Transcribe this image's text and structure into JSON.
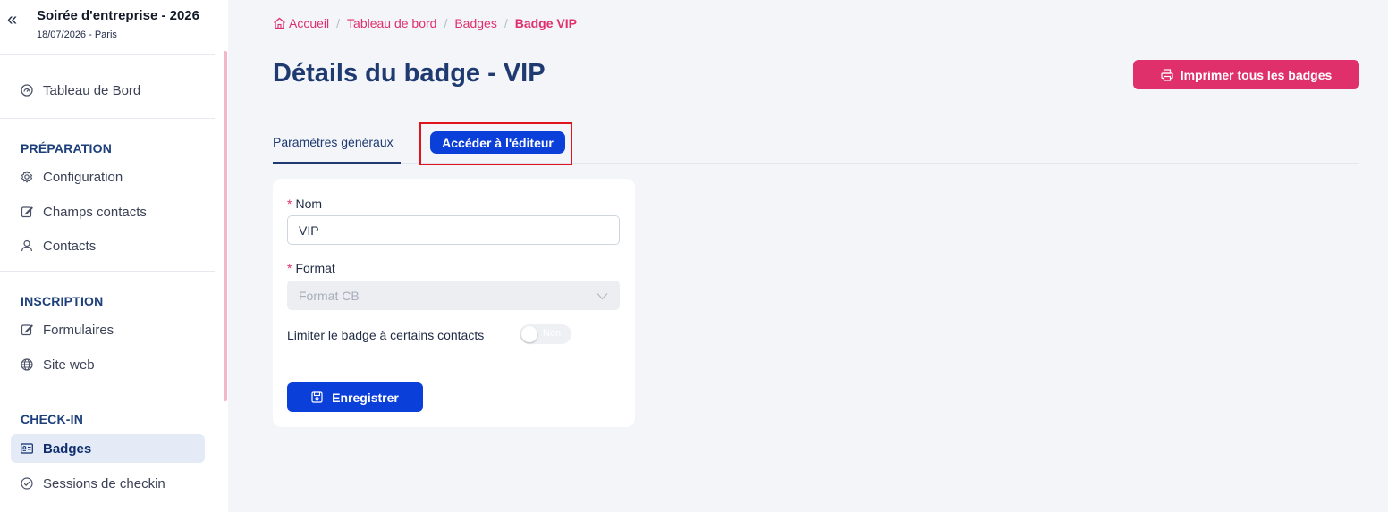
{
  "event": {
    "title": "Soirée d'entreprise - 2026",
    "subtitle": "18/07/2026 - Paris",
    "collapse_icon": "«"
  },
  "sidebar": {
    "dashboard": "Tableau de Bord",
    "sections": [
      {
        "title": "PRÉPARATION",
        "items": [
          "Configuration",
          "Champs contacts",
          "Contacts"
        ]
      },
      {
        "title": "INSCRIPTION",
        "items": [
          "Formulaires",
          "Site web"
        ]
      },
      {
        "title": "CHECK-IN",
        "items": [
          "Badges",
          "Sessions de checkin"
        ]
      }
    ],
    "active_item": "Badges"
  },
  "breadcrumb": {
    "items": [
      "Accueil",
      "Tableau de bord",
      "Badges"
    ],
    "current": "Badge VIP",
    "separator": "/"
  },
  "page": {
    "title": "Détails du badge - VIP",
    "print_button": "Imprimer tous les badges"
  },
  "tabs": {
    "general": "Paramètres généraux",
    "editor": "Accéder à l'éditeur"
  },
  "form": {
    "name_label": "Nom",
    "name_value": "VIP",
    "format_label": "Format",
    "format_value": "Format CB",
    "limit_label": "Limiter le badge à certains contacts",
    "limit_toggle_text": "Non",
    "limit_toggle_on": false,
    "required_marker": "*",
    "save_button": "Enregistrer"
  },
  "colors": {
    "accent_pink": "#e0306b",
    "primary_blue": "#0b3fd9",
    "title_navy": "#1e3a70",
    "highlight_red": "#e0141c"
  }
}
